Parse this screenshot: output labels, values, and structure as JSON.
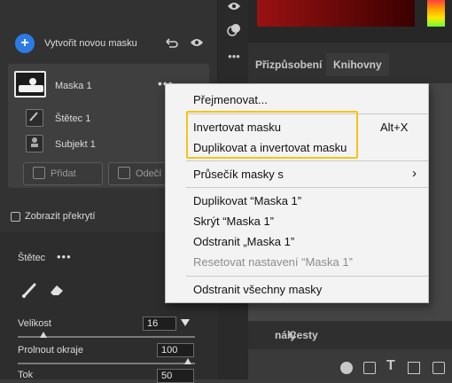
{
  "masks_panel": {
    "create_mask_label": "Vytvořit novou masku",
    "mask_item_label": "Maska 1",
    "sub_items": [
      {
        "label": "Štětec 1",
        "icon": "brush-icon"
      },
      {
        "label": "Subjekt 1",
        "icon": "subject-icon"
      }
    ],
    "add_button_label": "Přidat",
    "subtract_button_label": "Odečí",
    "show_overlay_label": "Zobrazit překrytí"
  },
  "brush_panel": {
    "title": "Štětec",
    "size_label": "Velikost",
    "size_value": "16",
    "feather_label": "Prolnout okraje",
    "feather_value": "100",
    "flow_label": "Tok",
    "flow_value": "50"
  },
  "right_panel": {
    "tabs": [
      "Přizpůsobení",
      "Knihovny"
    ],
    "lower_tabs": [
      "nály",
      "Cesty"
    ]
  },
  "context_menu": {
    "items": [
      {
        "label": "Přejmenovat...",
        "disabled": false
      },
      {
        "label": "Invertovat masku",
        "shortcut": "Alt+X",
        "disabled": false
      },
      {
        "label": "Duplikovat a invertovat masku",
        "disabled": false
      },
      {
        "label": "Průsečík masky s",
        "submenu": true,
        "disabled": false
      },
      {
        "label": "Duplikovat “Maska 1”",
        "disabled": false
      },
      {
        "label": "Skrýt “Maska 1”",
        "disabled": false
      },
      {
        "label": "Odstranit „Maska 1”",
        "disabled": false
      },
      {
        "label": "Resetovat nastavení “Maska 1”",
        "disabled": true
      },
      {
        "label": "Odstranit všechny masky",
        "disabled": false
      }
    ],
    "submenu_arrow": "›"
  },
  "colors": {
    "accent_blue": "#2c7be5",
    "highlight_yellow": "#f5c414",
    "menu_bg": "#f3f3f3"
  }
}
